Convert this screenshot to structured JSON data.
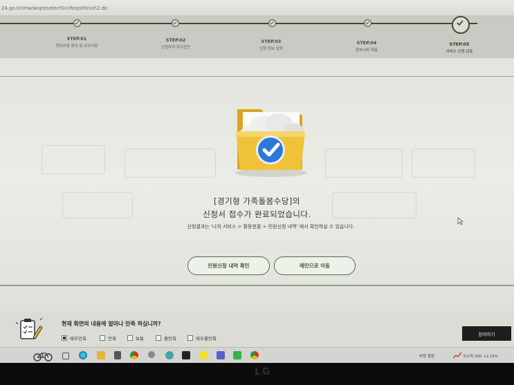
{
  "browser": {
    "url": "24.go.kr/mw/wspt/selectSvcReqstFinish2.do"
  },
  "steps": [
    {
      "title": "STEP.01",
      "desc": "정보이용 동의 및 유의사항"
    },
    {
      "title": "STEP.02",
      "desc": "신청자격 자가진단"
    },
    {
      "title": "STEP.03",
      "desc": "신청 정보 입력"
    },
    {
      "title": "STEP.04",
      "desc": "첨부서류 제출"
    },
    {
      "title": "STEP.05",
      "desc": "서비스 신청 완료"
    }
  ],
  "result": {
    "line1": "[경기형 가족돌봄수당]의",
    "line2": "신청서 접수가 완료되었습니다.",
    "sub": "신청결과는 '나의 서비스 > 활동현황 > 민원신청 내역' 에서 확인하실 수 있습니다."
  },
  "buttons": {
    "history": "민원신청 내역 확인",
    "main": "메인으로 이동"
  },
  "survey": {
    "question": "현재 화면의 내용에 얼마나 만족 하십니까?",
    "options": [
      "매우만족",
      "만족",
      "보통",
      "불만족",
      "매우불만족"
    ],
    "selected": "매우만족",
    "participate": "참여하기"
  },
  "taskbar": {
    "weather": "바람 좋음",
    "stock": "코스피  200  +2.16%"
  },
  "bezel": {
    "brand": "LG"
  },
  "colors": {
    "accent_green": "#3a5734",
    "check_blue": "#2b78d8",
    "folder_yellow": "#f0c23a"
  }
}
